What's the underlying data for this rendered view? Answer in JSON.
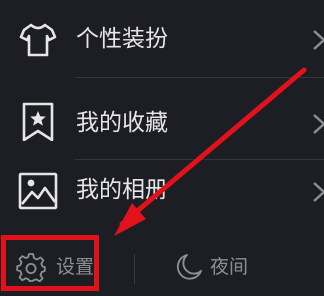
{
  "menu": {
    "items": [
      {
        "label": "个性装扮",
        "icon": "tshirt-icon"
      },
      {
        "label": "我的收藏",
        "icon": "bookmark-star-icon"
      },
      {
        "label": "我的相册",
        "icon": "photo-icon"
      }
    ]
  },
  "bottom_bar": {
    "settings_label": "设置",
    "settings_icon": "gear-icon",
    "night_label": "夜间",
    "night_icon": "moon-icon"
  },
  "colors": {
    "background": "#1d1e23",
    "text": "#e6e6e8",
    "muted_text": "#8e8f96",
    "annotation": "#e1121b"
  }
}
